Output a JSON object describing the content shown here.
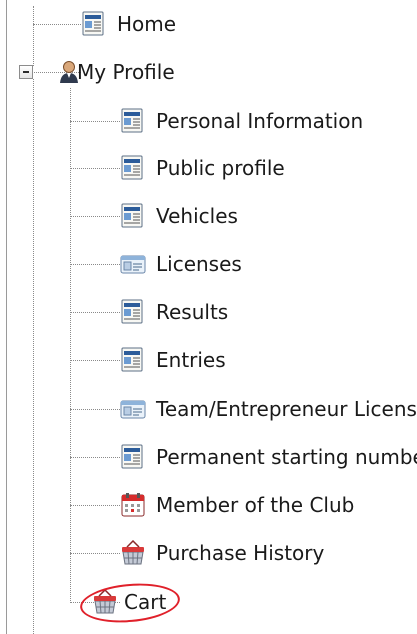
{
  "tree": {
    "root": [
      {
        "label": "Home",
        "icon": "page-icon"
      },
      {
        "label": "My Profile",
        "icon": "user-icon",
        "expanded": true,
        "children": [
          {
            "label": "Personal Information",
            "icon": "page-icon"
          },
          {
            "label": "Public profile",
            "icon": "page-icon"
          },
          {
            "label": "Vehicles",
            "icon": "page-icon"
          },
          {
            "label": "Licenses",
            "icon": "id-card-icon"
          },
          {
            "label": "Results",
            "icon": "page-icon"
          },
          {
            "label": "Entries",
            "icon": "page-icon"
          },
          {
            "label": "Team/Entrepreneur Licenses",
            "icon": "id-card-icon"
          },
          {
            "label": "Permanent starting numbers",
            "icon": "page-icon"
          },
          {
            "label": "Member of the Club",
            "icon": "calendar-icon"
          },
          {
            "label": "Purchase History",
            "icon": "cart-icon"
          },
          {
            "label": "Cart",
            "icon": "cart-icon",
            "highlighted": true
          }
        ]
      }
    ]
  },
  "colors": {
    "highlight": "#e0202a",
    "tree_lines": "#8a8a8a",
    "border": "#9a9a9a"
  }
}
